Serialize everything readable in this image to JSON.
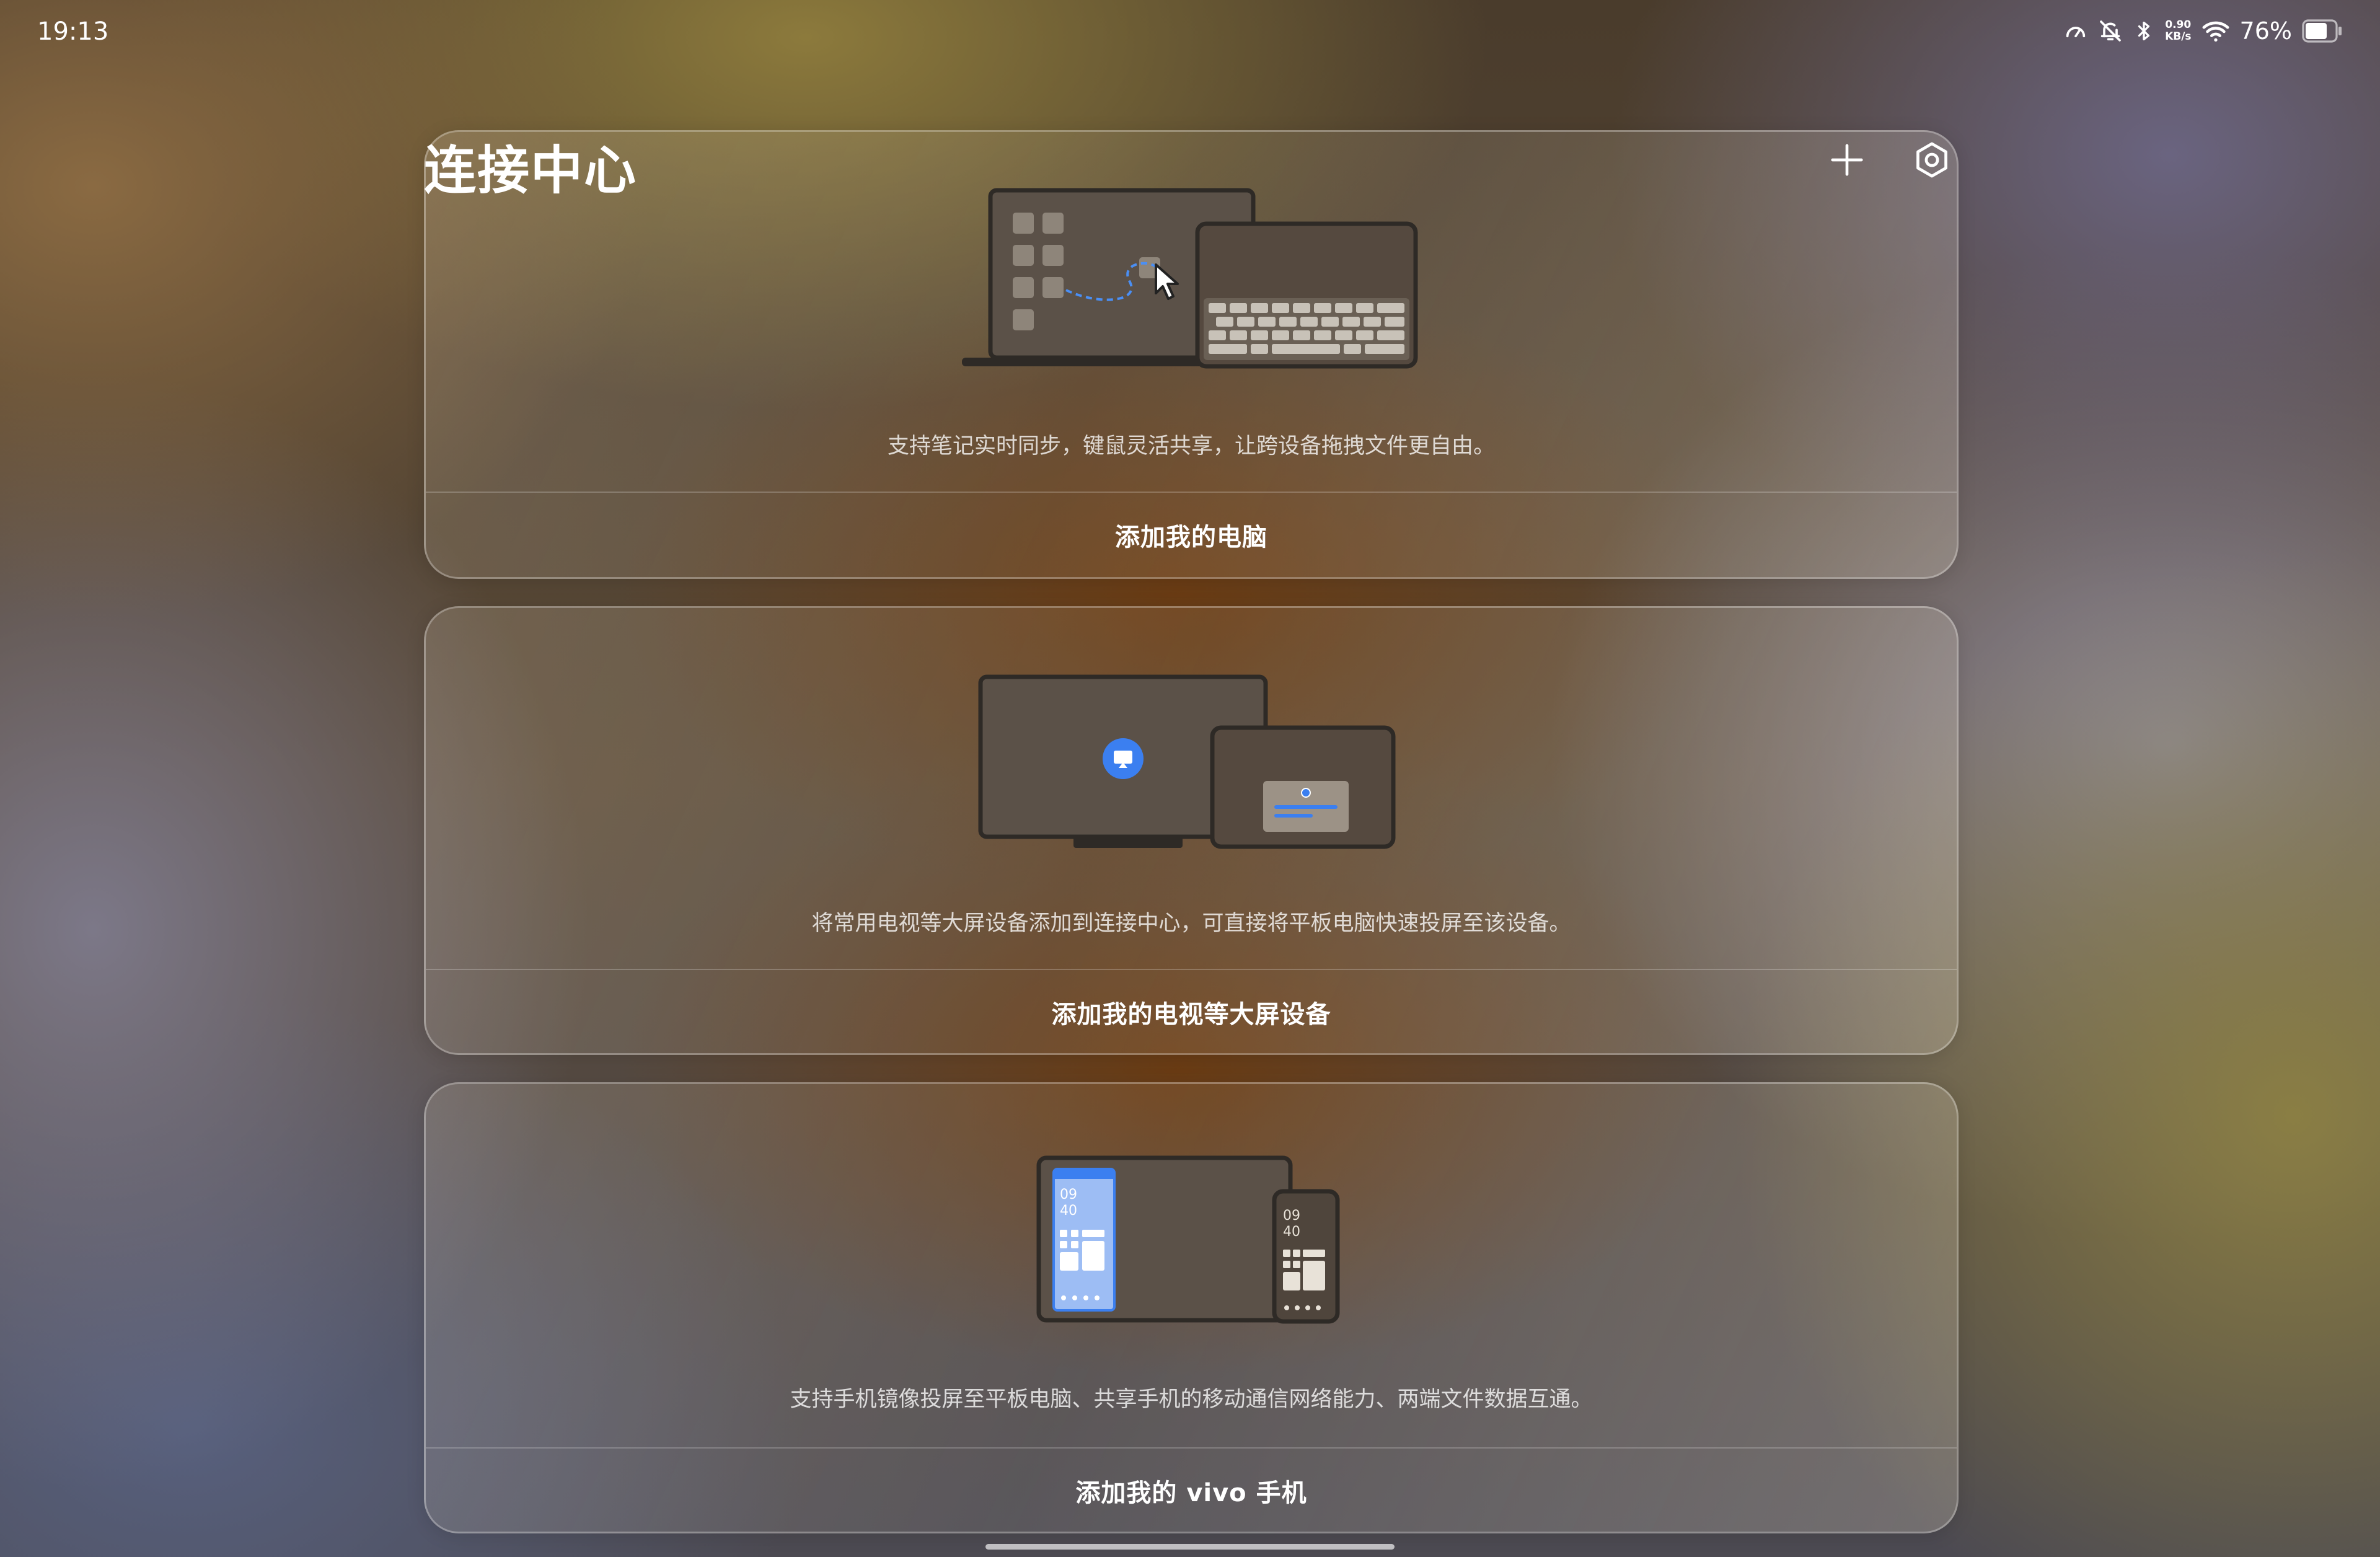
{
  "status_bar": {
    "time": "19:13",
    "net_speed_value": "0.90",
    "net_speed_unit": "KB/s",
    "battery": "76%",
    "icons": [
      "speedometer-icon",
      "bell-off-icon",
      "bluetooth-icon",
      "wifi-icon",
      "battery-icon"
    ]
  },
  "header": {
    "title": "连接中心",
    "actions": [
      "plus-icon",
      "settings-icon"
    ]
  },
  "cards": [
    {
      "illustration": "laptop-tablet-keyboard",
      "description": "支持笔记实时同步，键鼠灵活共享，让跨设备拖拽文件更自由。",
      "action_label": "添加我的电脑"
    },
    {
      "illustration": "tv-tablet-cast",
      "description": "将常用电视等大屏设备添加到连接中心，可直接将平板电脑快速投屏至该设备。",
      "action_label": "添加我的电视等大屏设备"
    },
    {
      "illustration": "tablet-phone-mirror",
      "description": "支持手机镜像投屏至平板电脑、共享手机的移动通信网络能力、两端文件数据互通。",
      "action_label": "添加我的 vivo 手机",
      "phone_clock_hour": "09",
      "phone_clock_minute": "40"
    }
  ],
  "colors": {
    "accent_blue": "#3b7ff0",
    "illustration_stroke": "#2e2a26"
  }
}
